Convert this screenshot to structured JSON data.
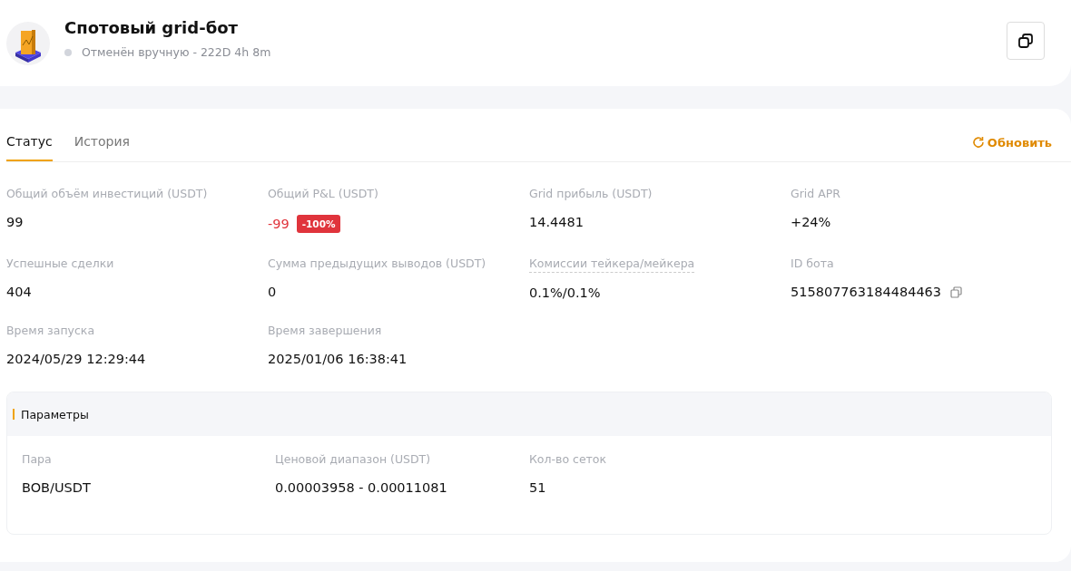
{
  "header": {
    "title": "Спотовый grid-бот",
    "status": "Отменён вручную - 222D 4h 8m"
  },
  "tabs": [
    {
      "label": "Статус",
      "selected": true
    },
    {
      "label": "История",
      "selected": false
    }
  ],
  "refresh": {
    "label": "Обновить"
  },
  "stats": [
    {
      "kind": "text",
      "label": "Общий объём инвестиций (USDT)",
      "value": "99"
    },
    {
      "kind": "pnl",
      "label": "Общий P&L (USDT)",
      "value": "-99",
      "badge": "-100%"
    },
    {
      "kind": "text",
      "label": "Grid прибыль (USDT)",
      "value": "14.4481"
    },
    {
      "kind": "text",
      "label": "Grid APR",
      "value": "+24%"
    },
    {
      "kind": "text",
      "label": "Успешные сделки",
      "value": "404"
    },
    {
      "kind": "text",
      "label": "Сумма предыдущих выводов (USDT)",
      "value": "0"
    },
    {
      "kind": "tooltip",
      "label": "Комиссии тейкера/мейкера",
      "value": "0.1%/0.1%"
    },
    {
      "kind": "copyable",
      "label": "ID бота",
      "value": "515807763184484463"
    },
    {
      "kind": "text",
      "label": "Время запуска",
      "value": "2024/05/29 12:29:44"
    },
    {
      "kind": "text",
      "label": "Время завершения",
      "value": "2025/01/06 16:38:41"
    }
  ],
  "parameters": {
    "title": "Параметры",
    "items": [
      {
        "label": "Пара",
        "value": "BOB/USDT"
      },
      {
        "label": "Ценовой диапазон (USDT)",
        "value": "0.00003958 - 0.00011081"
      },
      {
        "label": "Кол-во сеток",
        "value": "51"
      }
    ]
  }
}
